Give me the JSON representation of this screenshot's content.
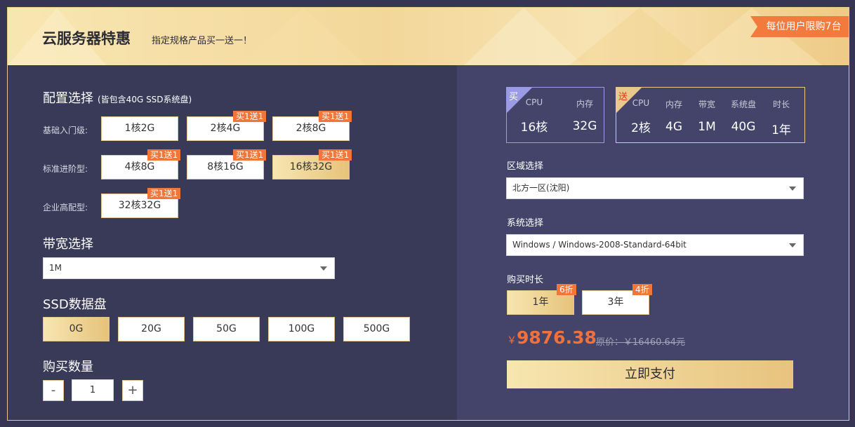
{
  "header": {
    "title": "云服务器特惠",
    "subtitle": "指定规格产品买一送一！",
    "limit_ribbon": "每位用户限购7台"
  },
  "config": {
    "title": "配置选择",
    "note": "(皆包含40G SSD系统盘)",
    "rows": [
      {
        "label": "基础入门级:",
        "options": [
          {
            "label": "1核2G",
            "badge": ""
          },
          {
            "label": "2核4G",
            "badge": "买1送1"
          },
          {
            "label": "2核8G",
            "badge": "买1送1"
          }
        ]
      },
      {
        "label": "标准进阶型:",
        "options": [
          {
            "label": "4核8G",
            "badge": "买1送1"
          },
          {
            "label": "8核16G",
            "badge": "买1送1"
          },
          {
            "label": "16核32G",
            "badge": "买1送1",
            "selected": true
          }
        ]
      },
      {
        "label": "企业高配型:",
        "options": [
          {
            "label": "32核32G",
            "badge": "买1送1"
          }
        ]
      }
    ]
  },
  "bandwidth": {
    "title": "带宽选择",
    "value": "1M"
  },
  "ssd": {
    "title": "SSD数据盘",
    "options": [
      "0G",
      "20G",
      "50G",
      "100G",
      "500G"
    ],
    "selected": "0G"
  },
  "quantity": {
    "title": "购买数量",
    "minus": "-",
    "value": "1",
    "plus": "+"
  },
  "buy_card": {
    "corner": "买",
    "columns": [
      {
        "header": "CPU",
        "value": "16核"
      },
      {
        "header": "内存",
        "value": "32G"
      }
    ]
  },
  "gift_card": {
    "corner": "送",
    "columns": [
      {
        "header": "CPU",
        "value": "2核"
      },
      {
        "header": "内存",
        "value": "4G"
      },
      {
        "header": "带宽",
        "value": "1M"
      },
      {
        "header": "系统盘",
        "value": "40G"
      },
      {
        "header": "时长",
        "value": "1年"
      }
    ]
  },
  "region": {
    "title": "区域选择",
    "value": "北方一区(沈阳)"
  },
  "system": {
    "title": "系统选择",
    "value": "Windows / Windows-2008-Standard-64bit"
  },
  "duration": {
    "title": "购买时长",
    "options": [
      {
        "label": "1年",
        "badge": "6折",
        "selected": true
      },
      {
        "label": "3年",
        "badge": "4折"
      }
    ]
  },
  "price": {
    "symbol": "￥",
    "value": "9876.38",
    "original": "原价：￥16460.64元"
  },
  "pay_button": "立即支付",
  "colors": {
    "accent": "#f0763a",
    "gold": "#e7c98c",
    "left_bg": "#393a58",
    "right_bg": "#44446a"
  }
}
